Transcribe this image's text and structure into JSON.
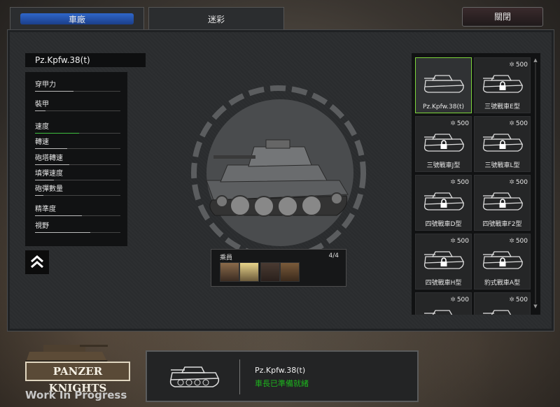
{
  "tabs": [
    {
      "label": "車廠",
      "active": true
    },
    {
      "label": "迷彩",
      "active": false
    }
  ],
  "close_label": "關閉",
  "selected_tank": {
    "name": "Pz.Kpfw.38(t)"
  },
  "stats": [
    {
      "label": "穿甲力",
      "value": 0.45
    },
    {
      "label": "裝甲",
      "value": 0.12
    },
    {
      "label": "速度",
      "value": 0.52,
      "highlight": true
    },
    {
      "label": "轉速",
      "value": 0.38
    },
    {
      "label": "砲塔轉速",
      "value": 0.4
    },
    {
      "label": "填彈速度",
      "value": 0.22
    },
    {
      "label": "砲彈數量",
      "value": 0.1
    },
    {
      "label": "精準度",
      "value": 0.55
    },
    {
      "label": "視野",
      "value": 0.65
    }
  ],
  "crew": {
    "title": "乘員",
    "count": "4/4"
  },
  "tank_list": [
    {
      "label": "Pz.Kpfw.38(t)",
      "selected": true,
      "locked": false,
      "cost": ""
    },
    {
      "label": "三號戰車E型",
      "selected": false,
      "locked": true,
      "cost": "500"
    },
    {
      "label": "三號戰車J型",
      "selected": false,
      "locked": true,
      "cost": "500"
    },
    {
      "label": "三號戰車L型",
      "selected": false,
      "locked": true,
      "cost": "500"
    },
    {
      "label": "四號戰車D型",
      "selected": false,
      "locked": true,
      "cost": "500"
    },
    {
      "label": "四號戰車F2型",
      "selected": false,
      "locked": true,
      "cost": "500"
    },
    {
      "label": "四號戰車H型",
      "selected": false,
      "locked": true,
      "cost": "500"
    },
    {
      "label": "豹式戰車A型",
      "selected": false,
      "locked": true,
      "cost": "500"
    },
    {
      "label": "",
      "selected": false,
      "locked": true,
      "cost": "500"
    },
    {
      "label": "",
      "selected": false,
      "locked": true,
      "cost": "500"
    }
  ],
  "logo": {
    "title": "PANZER KNIGHTS",
    "subtitle": "Work In Progress"
  },
  "bottom_panel": {
    "name": "Pz.Kpfw.38(t)",
    "status": "車長已準備就緒"
  }
}
